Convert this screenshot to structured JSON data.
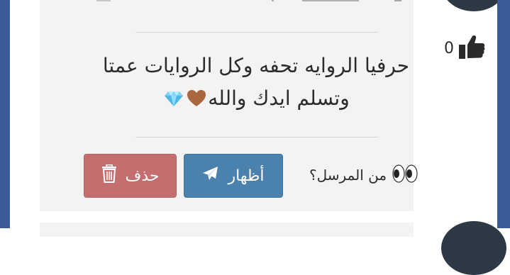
{
  "post": {
    "message_line1": "حرفيا الروايه تحفه وكل الروايات عمتا",
    "message_line2": "وتسلم ايدك والله",
    "message_line2_emojis": [
      "brown-heart-icon",
      "gem-icon"
    ]
  },
  "actions": {
    "show_label": "أظهار",
    "delete_label": "حذف"
  },
  "sender_question": {
    "text": "من المرسل؟",
    "icon": "eyes-icon"
  },
  "like": {
    "count": "0",
    "icon": "thumbs-up-icon"
  },
  "colors": {
    "frame_blue": "#3a5a99",
    "show_button": "#4a82ad",
    "delete_button": "#c46e70",
    "card_background": "#f3f3f3"
  }
}
